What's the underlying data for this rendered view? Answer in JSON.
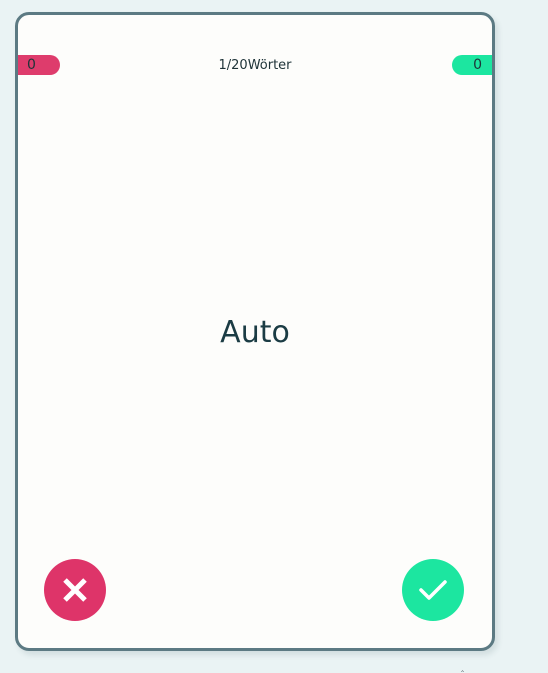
{
  "counters": {
    "wrong": "0",
    "right": "0"
  },
  "progress": {
    "current": "1",
    "separator": "/",
    "total": "20",
    "unit": "Wörter"
  },
  "card": {
    "word": "Auto"
  },
  "actions": {
    "wrong_icon": "close-icon",
    "right_icon": "check-icon"
  },
  "colors": {
    "background": "#eaf3f4",
    "card_border": "#5c7a83",
    "wrong": "#de3469",
    "right": "#1ce6a0",
    "text": "#1b3c44"
  }
}
